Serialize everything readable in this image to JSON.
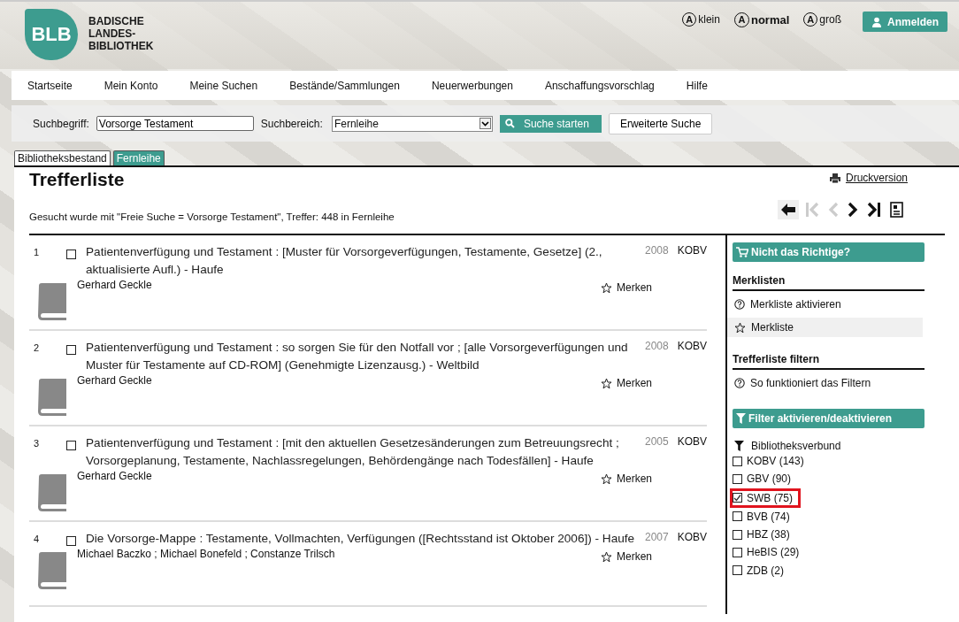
{
  "header": {
    "logo": {
      "mark": "BLB",
      "lines": [
        "BADISCHE",
        "LANDES-",
        "BIBLIOTHEK"
      ]
    },
    "font_sizes": [
      {
        "glyph": "A",
        "label": "klein",
        "selected": false
      },
      {
        "glyph": "A",
        "label": "normal",
        "selected": true
      },
      {
        "glyph": "A",
        "label": "groß",
        "selected": false
      }
    ],
    "login_button": "Anmelden"
  },
  "nav": [
    "Startseite",
    "Mein Konto",
    "Meine Suchen",
    "Bestände/Sammlungen",
    "Neuerwerbungen",
    "Anschaffungsvorschlag",
    "Hilfe"
  ],
  "search": {
    "term_label": "Suchbegriff:",
    "term_value": "Vorsorge Testament",
    "scope_label": "Suchbereich:",
    "scope_value": "Fernleihe",
    "submit": "Suche starten",
    "advanced": "Erweiterte Suche"
  },
  "tabs": [
    {
      "label": "Bibliotheksbestand",
      "selected": false
    },
    {
      "label": "Fernleihe",
      "selected": true
    }
  ],
  "results": {
    "title": "Trefferliste",
    "print_link": "Druckversion",
    "summary": "Gesucht wurde mit \"Freie Suche = Vorsorge Testament\", Treffer: 448 in Fernleihe",
    "pager": [
      {
        "kind": "back",
        "disabled": false
      },
      {
        "kind": "first",
        "disabled": true
      },
      {
        "kind": "prev",
        "disabled": true
      },
      {
        "kind": "next",
        "disabled": false
      },
      {
        "kind": "last",
        "disabled": false
      },
      {
        "kind": "detail",
        "disabled": false
      }
    ],
    "items": [
      {
        "number": "1",
        "checked": false,
        "title": "Patientenverfügung und Testament : [Muster für Vorsorgeverfügungen, Testamente, Gesetze] (2., aktualisierte Aufl.) - Haufe",
        "year": "2008",
        "source": "KOBV",
        "authors": "Gerhard Geckle",
        "bookmark": "Merken"
      },
      {
        "number": "2",
        "checked": false,
        "title": "Patientenverfügung und Testament : so sorgen Sie für den Notfall vor ; [alle Vorsorgeverfügungen und Muster für Testamente auf CD-ROM] (Genehmigte Lizenzausg.) - Weltbild",
        "year": "2008",
        "source": "KOBV",
        "authors": "Gerhard Geckle",
        "bookmark": "Merken"
      },
      {
        "number": "3",
        "checked": false,
        "title": "Patientenverfügung und Testament : [mit den aktuellen Gesetzesänderungen zum Betreuungsrecht ; Vorsorgeplanung, Testamente, Nachlassregelungen, Behördengänge nach Todesfällen] - Haufe",
        "year": "2005",
        "source": "KOBV",
        "authors": "Gerhard Geckle",
        "bookmark": "Merken"
      },
      {
        "number": "4",
        "checked": false,
        "title": "Die Vorsorge-Mappe : Testamente, Vollmachten, Verfügungen ([Rechtsstand ist Oktober 2006]) - Haufe",
        "year": "2007",
        "source": "KOBV",
        "authors": "Michael Baczko ; Michael Bonefeld ; Constanze Trilsch",
        "bookmark": "Merken"
      }
    ]
  },
  "sidebar": {
    "wrong_button": "Nicht das Richtige?",
    "lists_heading": "Merklisten",
    "lists_links": [
      {
        "kind": "help",
        "label": "Merkliste aktivieren",
        "highlighted": false
      },
      {
        "kind": "star",
        "label": "Merkliste",
        "highlighted": true
      }
    ],
    "filter_heading": "Trefferliste filtern",
    "filter_help": "So funktioniert das Filtern",
    "filter_toggle": "Filter aktivieren/deaktivieren",
    "facet": {
      "label": "Bibliotheksverbund",
      "options": [
        {
          "label": "KOBV (143)",
          "checked": false,
          "highlighted": false
        },
        {
          "label": "GBV (90)",
          "checked": false,
          "highlighted": false
        },
        {
          "label": "SWB (75)",
          "checked": true,
          "highlighted": true
        },
        {
          "label": "BVB (74)",
          "checked": false,
          "highlighted": false
        },
        {
          "label": "HBZ (38)",
          "checked": false,
          "highlighted": false
        },
        {
          "label": "HeBIS (29)",
          "checked": false,
          "highlighted": false
        },
        {
          "label": "ZDB (2)",
          "checked": false,
          "highlighted": false
        }
      ]
    }
  }
}
